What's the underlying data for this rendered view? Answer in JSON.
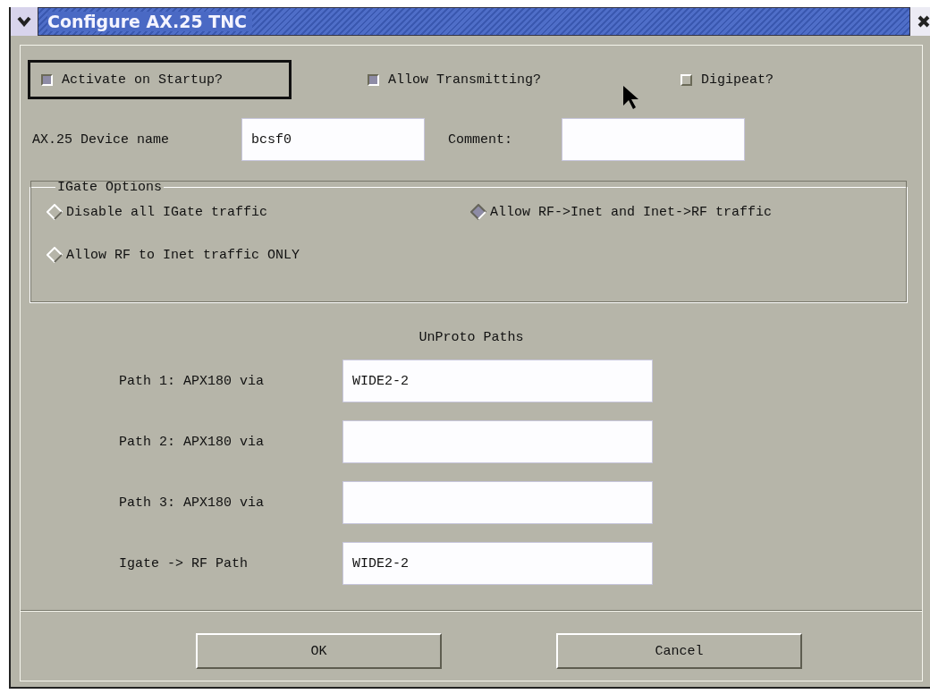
{
  "window": {
    "title": "Configure AX.25 TNC"
  },
  "checkboxes": [
    {
      "label": "Activate on Startup?",
      "checked": true,
      "focused": true
    },
    {
      "label": "Allow Transmitting?",
      "checked": true,
      "focused": false
    },
    {
      "label": "Digipeat?",
      "checked": false,
      "focused": false
    }
  ],
  "device_fields": [
    {
      "label": "AX.25 Device name",
      "value": "bcsf0"
    },
    {
      "label": "Comment:"
    }
  ],
  "igate_options": {
    "title": "IGate Options",
    "options": [
      {
        "label": "Disable all IGate traffic",
        "selected": false
      },
      {
        "label": "Allow RF->Inet and Inet->RF traffic",
        "selected": true
      },
      {
        "label": "Allow RF to Inet traffic ONLY",
        "selected": false
      }
    ]
  },
  "unproto_paths": {
    "title": "UnProto Paths",
    "paths": [
      {
        "label": "Path 1: APX180 via",
        "value": "WIDE2-2"
      },
      {
        "label": "Path 2: APX180 via"
      },
      {
        "label": "Path 3: APX180 via"
      },
      {
        "label": "Igate -> RF Path",
        "value": "WIDE2-2"
      }
    ]
  },
  "buttons": [
    "OK",
    "Cancel"
  ]
}
